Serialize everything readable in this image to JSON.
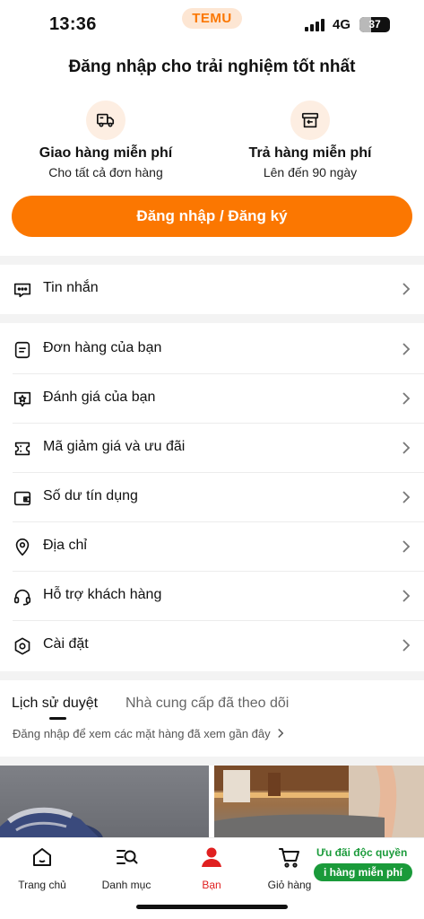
{
  "status_bar": {
    "time": "13:36",
    "brand": "TEMU",
    "network": "4G",
    "battery": "37",
    "battery_level_percent": 37
  },
  "promo": {
    "title": "Đăng nhập cho trải nghiệm tốt nhất",
    "items": [
      {
        "icon": "truck-icon",
        "name": "Giao hàng miễn phí",
        "sub": "Cho tất cả đơn hàng"
      },
      {
        "icon": "return-box-icon",
        "name": "Trả hàng miễn phí",
        "sub": "Lên đến 90 ngày"
      }
    ],
    "login_label": "Đăng nhập / Đăng ký"
  },
  "menu": {
    "messages": "Tin nhắn",
    "items": [
      {
        "icon": "order-icon",
        "label": "Đơn hàng của bạn"
      },
      {
        "icon": "review-icon",
        "label": "Đánh giá của bạn"
      },
      {
        "icon": "coupon-icon",
        "label": "Mã giảm giá và ưu đãi"
      },
      {
        "icon": "wallet-icon",
        "label": "Số dư tín dụng"
      },
      {
        "icon": "location-icon",
        "label": "Địa chỉ"
      },
      {
        "icon": "headset-icon",
        "label": "Hỗ trợ khách hàng"
      },
      {
        "icon": "settings-icon",
        "label": "Cài đặt"
      }
    ]
  },
  "history": {
    "tabs": [
      "Lịch sử duyệt",
      "Nhà cung cấp đã theo dõi"
    ],
    "hint": "Đăng nhập để xem các mặt hàng đã xem gần đây"
  },
  "bottom_nav": {
    "items": [
      {
        "icon": "home-icon",
        "label": "Trang chủ"
      },
      {
        "icon": "category-search-icon",
        "label": "Danh mục"
      },
      {
        "icon": "user-icon",
        "label": "Bạn"
      },
      {
        "icon": "cart-icon",
        "label": "Giỏ hàng"
      }
    ],
    "promo_text": "Ưu đãi độc quyền",
    "promo_pill": "i hàng miễn phí"
  },
  "colors": {
    "accent": "#fb7701",
    "active_nav": "#e02020",
    "promo_green": "#1a9a3a"
  }
}
